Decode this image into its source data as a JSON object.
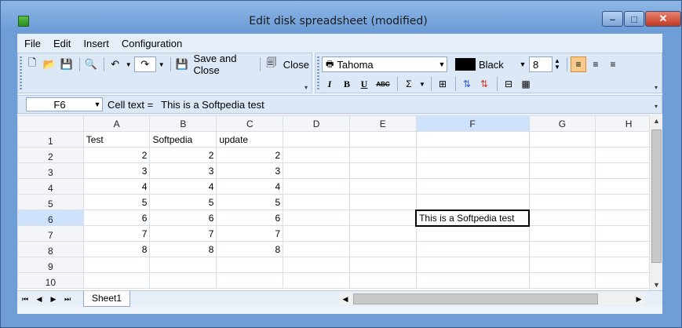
{
  "window": {
    "title": "Edit disk spreadsheet (modified)"
  },
  "menu": [
    "File",
    "Edit",
    "Insert",
    "Configuration"
  ],
  "toolbar": {
    "save_close_label": "Save and Close",
    "close_label": "Close"
  },
  "format": {
    "font_name": "Tahoma",
    "font_color": "Black",
    "font_size": "8",
    "bold": "B",
    "italic": "I",
    "underline": "U",
    "strike": "ABC",
    "sum": "Σ"
  },
  "formula": {
    "cell_ref": "F6",
    "label": "Cell text  =",
    "value": "This is a Softpedia test"
  },
  "grid": {
    "columns": [
      "A",
      "B",
      "C",
      "D",
      "E",
      "F",
      "G",
      "H"
    ],
    "rows": [
      "1",
      "2",
      "3",
      "4",
      "5",
      "6",
      "7",
      "8",
      "9",
      "10"
    ],
    "cells": [
      [
        "Test",
        "Softpedia",
        "update",
        "",
        "",
        "",
        "",
        ""
      ],
      [
        "2",
        "2",
        "2",
        "",
        "",
        "",
        "",
        ""
      ],
      [
        "3",
        "3",
        "3",
        "",
        "",
        "",
        "",
        ""
      ],
      [
        "4",
        "4",
        "4",
        "",
        "",
        "",
        "",
        ""
      ],
      [
        "5",
        "5",
        "5",
        "",
        "",
        "",
        "",
        ""
      ],
      [
        "6",
        "6",
        "6",
        "",
        "",
        "This is a Softpedia test",
        "",
        ""
      ],
      [
        "7",
        "7",
        "7",
        "",
        "",
        "",
        "",
        ""
      ],
      [
        "8",
        "8",
        "8",
        "",
        "",
        "",
        "",
        ""
      ],
      [
        "",
        "",
        "",
        "",
        "",
        "",
        "",
        ""
      ],
      [
        "",
        "",
        "",
        "",
        "",
        "",
        "",
        ""
      ]
    ]
  },
  "sheets": [
    "Sheet1"
  ]
}
